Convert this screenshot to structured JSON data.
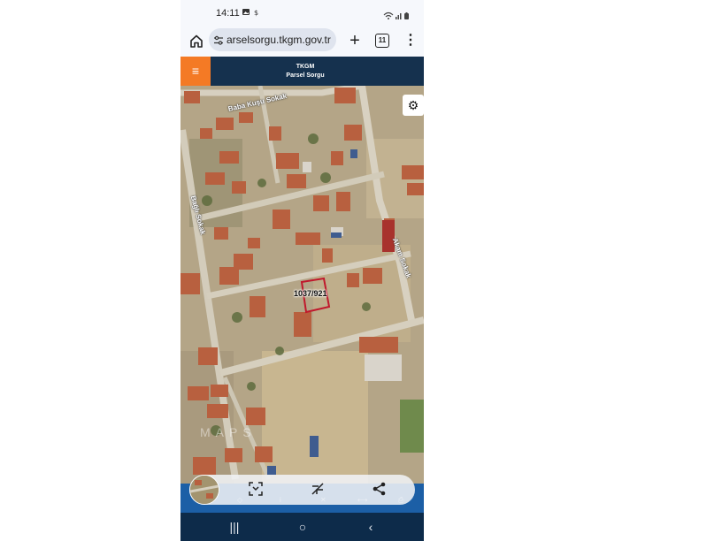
{
  "status_bar": {
    "time": "14:11",
    "left_icons": [
      "gallery-icon",
      "dollar-icon"
    ],
    "right_icons": [
      "wifi-icon",
      "signal-icon",
      "battery-icon"
    ]
  },
  "browser": {
    "url": "arselsorgu.tkgm.gov.tr",
    "tab_count": "11"
  },
  "app": {
    "title_line1": "TKGM",
    "title_line2": "Parsel Sorgu",
    "accent_color": "#f47a25",
    "header_color": "#15314e"
  },
  "map": {
    "parcel_label": "1037/921",
    "parcel_outline_color": "#c0182c",
    "streets": [
      "Baba Kuşu Sokak",
      "Bağlı Sokak",
      "Akam Sokak"
    ],
    "watermark": "MAPS"
  },
  "bottom_toolbar": {
    "buttons": [
      "scan-icon",
      "measure-icon",
      "share-icon"
    ],
    "sub_labels": [
      "◇",
      "i",
      "✕",
      "⟷",
      "⎙"
    ]
  },
  "nav_bar": {
    "recents_glyph": "|||",
    "home_glyph": "○",
    "back_glyph": "‹"
  }
}
